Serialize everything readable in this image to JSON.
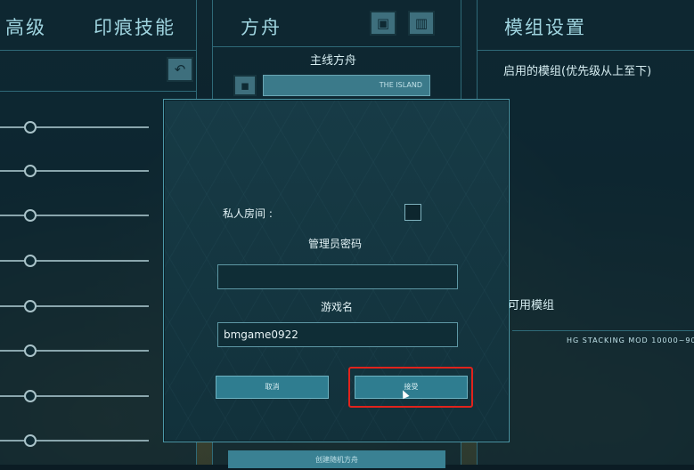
{
  "left_panel": {
    "tabs": [
      "高级",
      "印痕技能"
    ],
    "undo_icon": "undo-icon"
  },
  "mid_panel": {
    "title": "方舟",
    "subtitle": "主线方舟",
    "map_field_text": "THE ISLAND",
    "bottom_button": "创建随机方舟",
    "icons": [
      "save-icon",
      "server-icon"
    ]
  },
  "right_panel": {
    "title": "模组设置",
    "active_mods_label": "启用的模组(优先级从上至下)",
    "available_mods_label": "可用模组",
    "mod_entry": "HG  STACKING  MOD  10000~90"
  },
  "dialog": {
    "private_room_label": "私人房间 :",
    "private_room_checked": false,
    "admin_password_label": "管理员密码",
    "admin_password_value": "",
    "game_name_label": "游戏名",
    "game_name_value": "bmgame0922",
    "cancel_label": "取消",
    "accept_label": "接受"
  },
  "colors": {
    "accent": "#4c98a8",
    "highlight": "#e0231c"
  }
}
